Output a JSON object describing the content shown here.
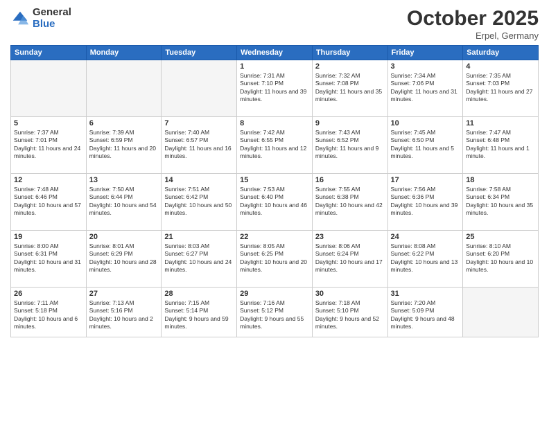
{
  "header": {
    "logo_general": "General",
    "logo_blue": "Blue",
    "month_title": "October 2025",
    "location": "Erpel, Germany"
  },
  "weekdays": [
    "Sunday",
    "Monday",
    "Tuesday",
    "Wednesday",
    "Thursday",
    "Friday",
    "Saturday"
  ],
  "weeks": [
    [
      {
        "day": "",
        "sunrise": "",
        "sunset": "",
        "daylight": "",
        "empty": true
      },
      {
        "day": "",
        "sunrise": "",
        "sunset": "",
        "daylight": "",
        "empty": true
      },
      {
        "day": "",
        "sunrise": "",
        "sunset": "",
        "daylight": "",
        "empty": true
      },
      {
        "day": "1",
        "sunrise": "Sunrise: 7:31 AM",
        "sunset": "Sunset: 7:10 PM",
        "daylight": "Daylight: 11 hours and 39 minutes.",
        "empty": false
      },
      {
        "day": "2",
        "sunrise": "Sunrise: 7:32 AM",
        "sunset": "Sunset: 7:08 PM",
        "daylight": "Daylight: 11 hours and 35 minutes.",
        "empty": false
      },
      {
        "day": "3",
        "sunrise": "Sunrise: 7:34 AM",
        "sunset": "Sunset: 7:06 PM",
        "daylight": "Daylight: 11 hours and 31 minutes.",
        "empty": false
      },
      {
        "day": "4",
        "sunrise": "Sunrise: 7:35 AM",
        "sunset": "Sunset: 7:03 PM",
        "daylight": "Daylight: 11 hours and 27 minutes.",
        "empty": false
      }
    ],
    [
      {
        "day": "5",
        "sunrise": "Sunrise: 7:37 AM",
        "sunset": "Sunset: 7:01 PM",
        "daylight": "Daylight: 11 hours and 24 minutes.",
        "empty": false
      },
      {
        "day": "6",
        "sunrise": "Sunrise: 7:39 AM",
        "sunset": "Sunset: 6:59 PM",
        "daylight": "Daylight: 11 hours and 20 minutes.",
        "empty": false
      },
      {
        "day": "7",
        "sunrise": "Sunrise: 7:40 AM",
        "sunset": "Sunset: 6:57 PM",
        "daylight": "Daylight: 11 hours and 16 minutes.",
        "empty": false
      },
      {
        "day": "8",
        "sunrise": "Sunrise: 7:42 AM",
        "sunset": "Sunset: 6:55 PM",
        "daylight": "Daylight: 11 hours and 12 minutes.",
        "empty": false
      },
      {
        "day": "9",
        "sunrise": "Sunrise: 7:43 AM",
        "sunset": "Sunset: 6:52 PM",
        "daylight": "Daylight: 11 hours and 9 minutes.",
        "empty": false
      },
      {
        "day": "10",
        "sunrise": "Sunrise: 7:45 AM",
        "sunset": "Sunset: 6:50 PM",
        "daylight": "Daylight: 11 hours and 5 minutes.",
        "empty": false
      },
      {
        "day": "11",
        "sunrise": "Sunrise: 7:47 AM",
        "sunset": "Sunset: 6:48 PM",
        "daylight": "Daylight: 11 hours and 1 minute.",
        "empty": false
      }
    ],
    [
      {
        "day": "12",
        "sunrise": "Sunrise: 7:48 AM",
        "sunset": "Sunset: 6:46 PM",
        "daylight": "Daylight: 10 hours and 57 minutes.",
        "empty": false
      },
      {
        "day": "13",
        "sunrise": "Sunrise: 7:50 AM",
        "sunset": "Sunset: 6:44 PM",
        "daylight": "Daylight: 10 hours and 54 minutes.",
        "empty": false
      },
      {
        "day": "14",
        "sunrise": "Sunrise: 7:51 AM",
        "sunset": "Sunset: 6:42 PM",
        "daylight": "Daylight: 10 hours and 50 minutes.",
        "empty": false
      },
      {
        "day": "15",
        "sunrise": "Sunrise: 7:53 AM",
        "sunset": "Sunset: 6:40 PM",
        "daylight": "Daylight: 10 hours and 46 minutes.",
        "empty": false
      },
      {
        "day": "16",
        "sunrise": "Sunrise: 7:55 AM",
        "sunset": "Sunset: 6:38 PM",
        "daylight": "Daylight: 10 hours and 42 minutes.",
        "empty": false
      },
      {
        "day": "17",
        "sunrise": "Sunrise: 7:56 AM",
        "sunset": "Sunset: 6:36 PM",
        "daylight": "Daylight: 10 hours and 39 minutes.",
        "empty": false
      },
      {
        "day": "18",
        "sunrise": "Sunrise: 7:58 AM",
        "sunset": "Sunset: 6:34 PM",
        "daylight": "Daylight: 10 hours and 35 minutes.",
        "empty": false
      }
    ],
    [
      {
        "day": "19",
        "sunrise": "Sunrise: 8:00 AM",
        "sunset": "Sunset: 6:31 PM",
        "daylight": "Daylight: 10 hours and 31 minutes.",
        "empty": false
      },
      {
        "day": "20",
        "sunrise": "Sunrise: 8:01 AM",
        "sunset": "Sunset: 6:29 PM",
        "daylight": "Daylight: 10 hours and 28 minutes.",
        "empty": false
      },
      {
        "day": "21",
        "sunrise": "Sunrise: 8:03 AM",
        "sunset": "Sunset: 6:27 PM",
        "daylight": "Daylight: 10 hours and 24 minutes.",
        "empty": false
      },
      {
        "day": "22",
        "sunrise": "Sunrise: 8:05 AM",
        "sunset": "Sunset: 6:25 PM",
        "daylight": "Daylight: 10 hours and 20 minutes.",
        "empty": false
      },
      {
        "day": "23",
        "sunrise": "Sunrise: 8:06 AM",
        "sunset": "Sunset: 6:24 PM",
        "daylight": "Daylight: 10 hours and 17 minutes.",
        "empty": false
      },
      {
        "day": "24",
        "sunrise": "Sunrise: 8:08 AM",
        "sunset": "Sunset: 6:22 PM",
        "daylight": "Daylight: 10 hours and 13 minutes.",
        "empty": false
      },
      {
        "day": "25",
        "sunrise": "Sunrise: 8:10 AM",
        "sunset": "Sunset: 6:20 PM",
        "daylight": "Daylight: 10 hours and 10 minutes.",
        "empty": false
      }
    ],
    [
      {
        "day": "26",
        "sunrise": "Sunrise: 7:11 AM",
        "sunset": "Sunset: 5:18 PM",
        "daylight": "Daylight: 10 hours and 6 minutes.",
        "empty": false
      },
      {
        "day": "27",
        "sunrise": "Sunrise: 7:13 AM",
        "sunset": "Sunset: 5:16 PM",
        "daylight": "Daylight: 10 hours and 2 minutes.",
        "empty": false
      },
      {
        "day": "28",
        "sunrise": "Sunrise: 7:15 AM",
        "sunset": "Sunset: 5:14 PM",
        "daylight": "Daylight: 9 hours and 59 minutes.",
        "empty": false
      },
      {
        "day": "29",
        "sunrise": "Sunrise: 7:16 AM",
        "sunset": "Sunset: 5:12 PM",
        "daylight": "Daylight: 9 hours and 55 minutes.",
        "empty": false
      },
      {
        "day": "30",
        "sunrise": "Sunrise: 7:18 AM",
        "sunset": "Sunset: 5:10 PM",
        "daylight": "Daylight: 9 hours and 52 minutes.",
        "empty": false
      },
      {
        "day": "31",
        "sunrise": "Sunrise: 7:20 AM",
        "sunset": "Sunset: 5:09 PM",
        "daylight": "Daylight: 9 hours and 48 minutes.",
        "empty": false
      },
      {
        "day": "",
        "sunrise": "",
        "sunset": "",
        "daylight": "",
        "empty": true
      }
    ]
  ]
}
